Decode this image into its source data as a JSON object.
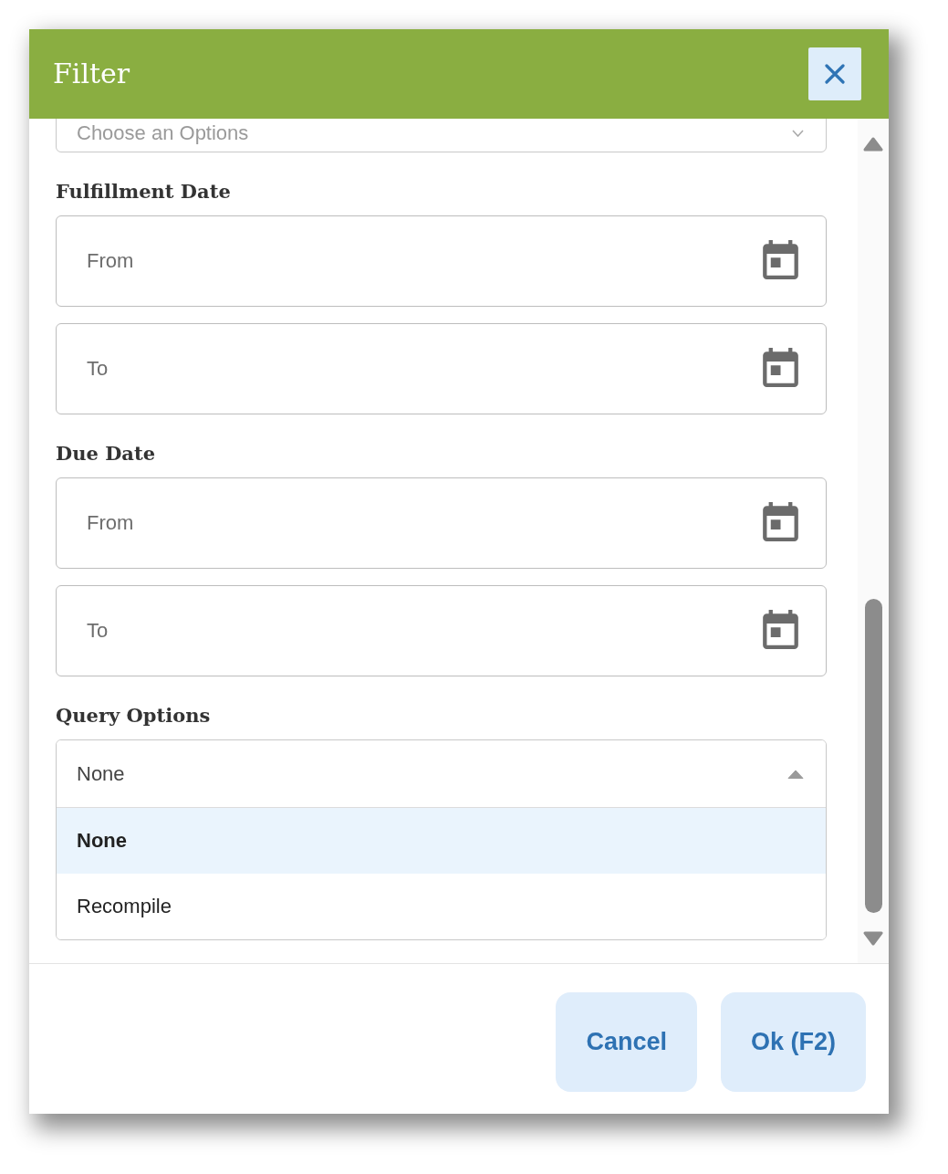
{
  "window": {
    "title": "Filter"
  },
  "sections": [
    {
      "kind": "select",
      "placeholder": "Choose an Options",
      "expanded": false
    },
    {
      "kind": "date_range",
      "label": "Fulfillment Date",
      "inputs": [
        {
          "placeholder": "From"
        },
        {
          "placeholder": "To"
        }
      ]
    },
    {
      "kind": "date_range",
      "label": "Due Date",
      "inputs": [
        {
          "placeholder": "From"
        },
        {
          "placeholder": "To"
        }
      ]
    },
    {
      "kind": "select",
      "label": "Query Options",
      "value": "None",
      "expanded": true,
      "options": [
        {
          "label": "None",
          "selected": true
        },
        {
          "label": "Recompile",
          "selected": false
        }
      ]
    }
  ],
  "buttons": [
    {
      "label": "Cancel"
    },
    {
      "label": "Ok (F2)"
    }
  ]
}
